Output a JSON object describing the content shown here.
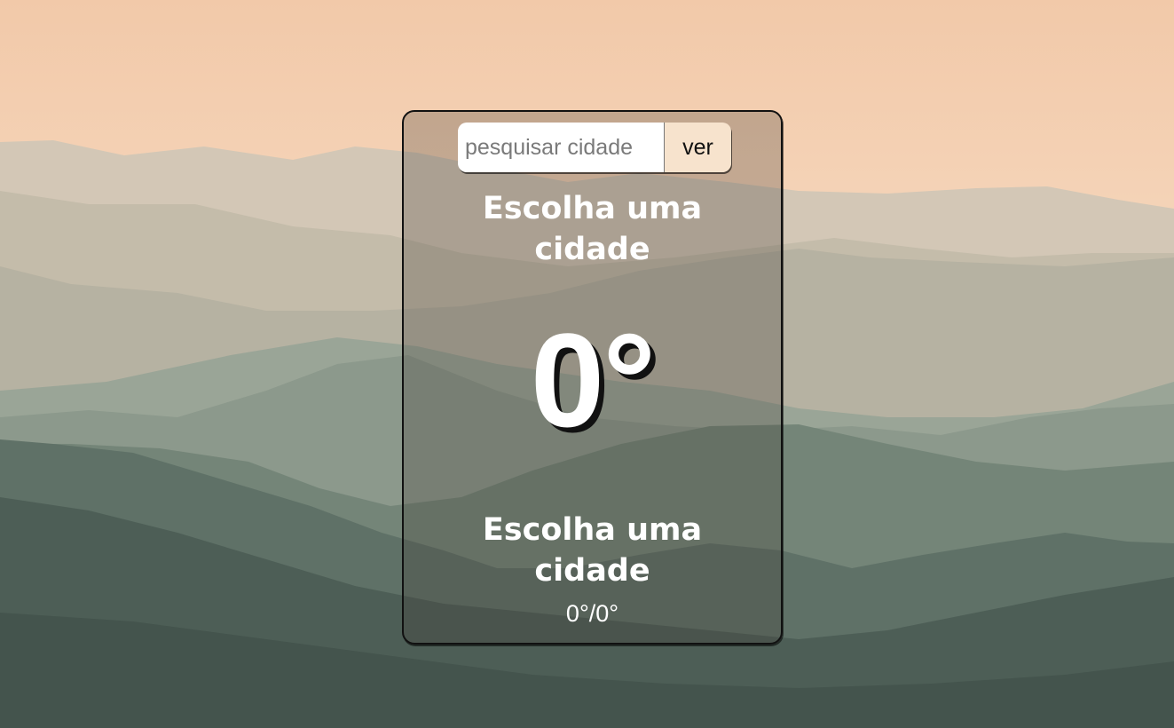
{
  "colors": {
    "sky_top": "#f4cfb1",
    "mountain_dark": "#3f5049",
    "card_border": "#111111",
    "button_bg": "#f7e3cd",
    "text_light": "#ffffff"
  },
  "search": {
    "placeholder": "pesquisar cidade",
    "value": "",
    "button_label": "ver"
  },
  "weather": {
    "city_heading_line1": "Escolha uma",
    "city_heading_line2": "cidade",
    "temperature": "0°",
    "city_name_line1": "Escolha uma",
    "city_name_line2": "cidade",
    "min_max": "0°/0°"
  }
}
